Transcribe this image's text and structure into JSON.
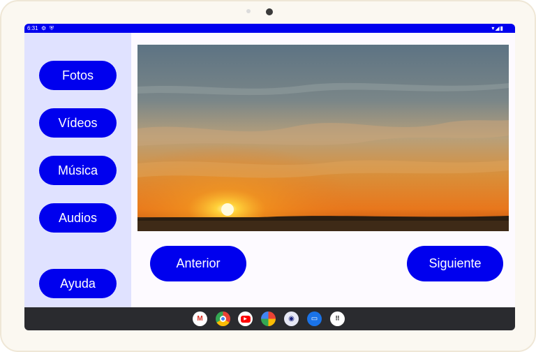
{
  "status_bar": {
    "time": "6:31",
    "icons": [
      "gear-icon",
      "shield-icon",
      "wifi-icon",
      "signal-icon",
      "battery-icon"
    ]
  },
  "sidebar": {
    "items": [
      {
        "label": "Fotos"
      },
      {
        "label": "Vídeos"
      },
      {
        "label": "Música"
      },
      {
        "label": "Audios"
      },
      {
        "label": "Ayuda"
      }
    ]
  },
  "main": {
    "image": "sunset-photo",
    "prev_label": "Anterior",
    "next_label": "Siguiente"
  },
  "taskbar": {
    "apps": [
      "gmail-icon",
      "chrome-icon",
      "youtube-icon",
      "photos-icon",
      "assistant-icon",
      "messages-icon",
      "app-drawer-icon"
    ]
  },
  "colors": {
    "accent": "#0000ee",
    "sidebar_bg": "#e0e2ff",
    "taskbar_bg": "#2a2b2f"
  }
}
